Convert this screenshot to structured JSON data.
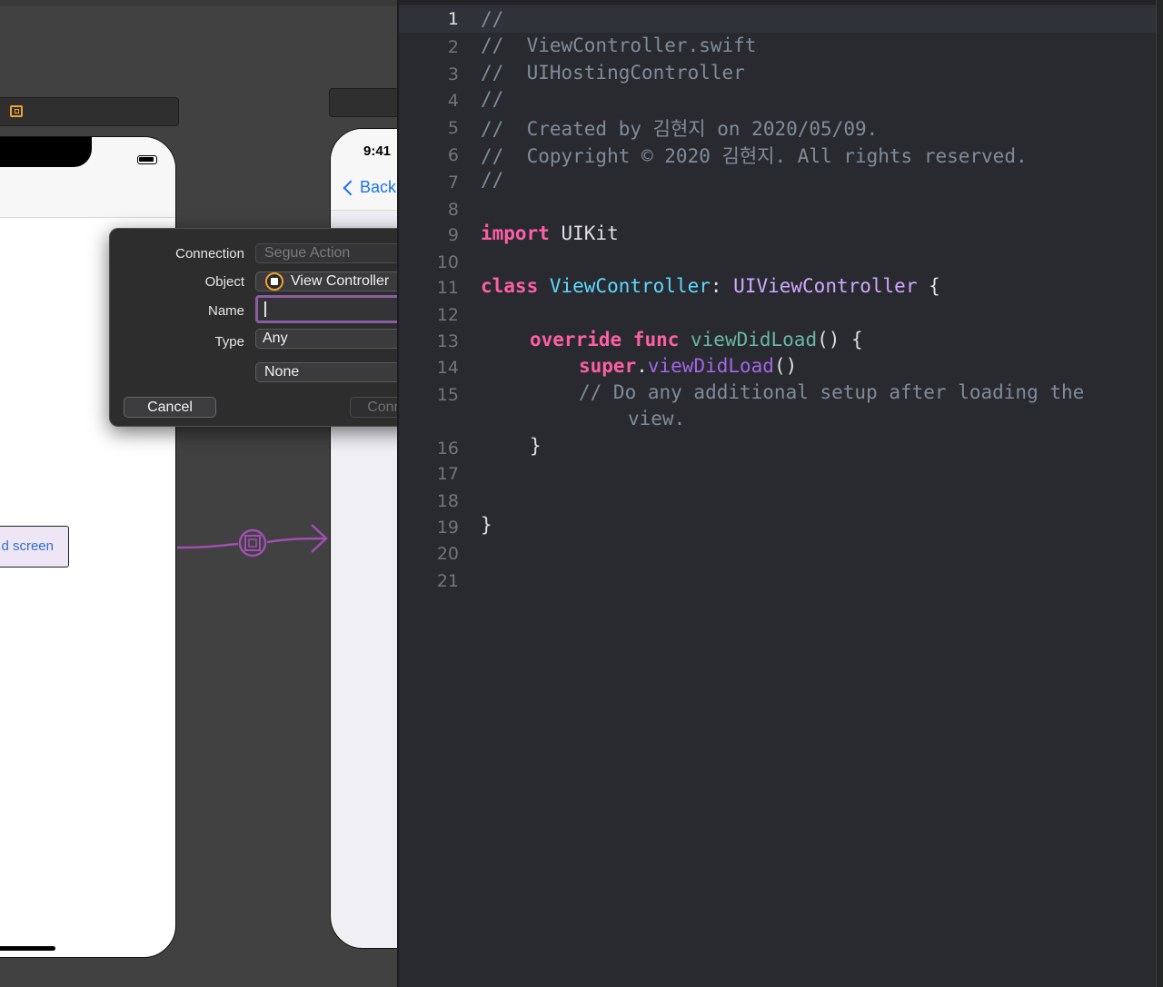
{
  "storyboard": {
    "phone_time": "9:41",
    "back_button": "Back",
    "screen_button_label": "d screen"
  },
  "popover": {
    "connection_label": "Connection",
    "connection_value": "Segue Action",
    "object_label": "Object",
    "object_value": "View Controller",
    "name_label": "Name",
    "name_value": "",
    "type_label": "Type",
    "type_value": "Any",
    "arguments_value": "None",
    "cancel_label": "Cancel",
    "connect_label": "Connect"
  },
  "editor": {
    "current_line": 1,
    "line_numbers": [
      "1",
      "2",
      "3",
      "4",
      "5",
      "6",
      "7",
      "8",
      "9",
      "10",
      "11",
      "12",
      "13",
      "14",
      "15",
      "16",
      "17",
      "18",
      "19",
      "20",
      "21"
    ],
    "lines": {
      "l1": "//",
      "l2": "//  ViewController.swift",
      "l3": "//  UIHostingController",
      "l4": "//",
      "l5": "//  Created by 김현지 on 2020/05/09.",
      "l6": "//  Copyright © 2020 김현지. All rights reserved.",
      "l7": "//",
      "import_kw": "import",
      "import_mod": " UIKit",
      "class_kw": "class",
      "class_name": " ViewController",
      "colon": ": ",
      "superclass": "UIViewController",
      "class_open": " {",
      "override_kw": "override",
      "func_kw": " func",
      "func_name": " viewDidLoad",
      "func_sig": "() {",
      "super_kw": "super",
      "dot": ".",
      "super_call": "viewDidLoad",
      "call_parens": "()",
      "comment_a": "// Do any additional setup after loading the",
      "comment_b": "view.",
      "close_func": "}",
      "close_class": "}"
    }
  }
}
